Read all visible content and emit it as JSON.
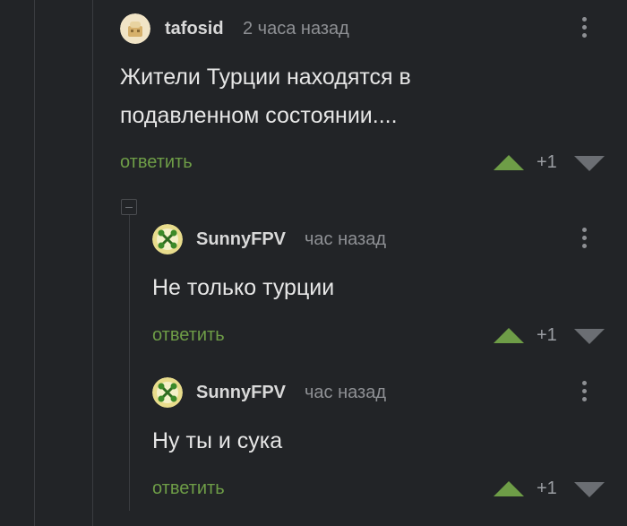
{
  "comments": [
    {
      "username": "tafosid",
      "time": "2 часа назад",
      "text_line1": "Жители Турции находятся в",
      "text_line2": "подавленном состоянии....",
      "reply_label": "ответить",
      "score": "+1"
    },
    {
      "username": "SunnyFPV",
      "time": "час назад",
      "text": "Не только турции",
      "reply_label": "ответить",
      "score": "+1"
    },
    {
      "username": "SunnyFPV",
      "time": "час назад",
      "text": "Ну ты и сука",
      "reply_label": "ответить",
      "score": "+1"
    }
  ],
  "colors": {
    "background": "#222427",
    "reply_link": "#6e9d47",
    "vote_up": "#6e9d47",
    "vote_down": "#6b6e73",
    "muted": "#8e9094"
  },
  "icons": [
    "avatar-tafosid",
    "avatar-sunnyfpv",
    "kebab-menu-icon",
    "upvote-icon",
    "downvote-icon",
    "collapse-icon"
  ]
}
